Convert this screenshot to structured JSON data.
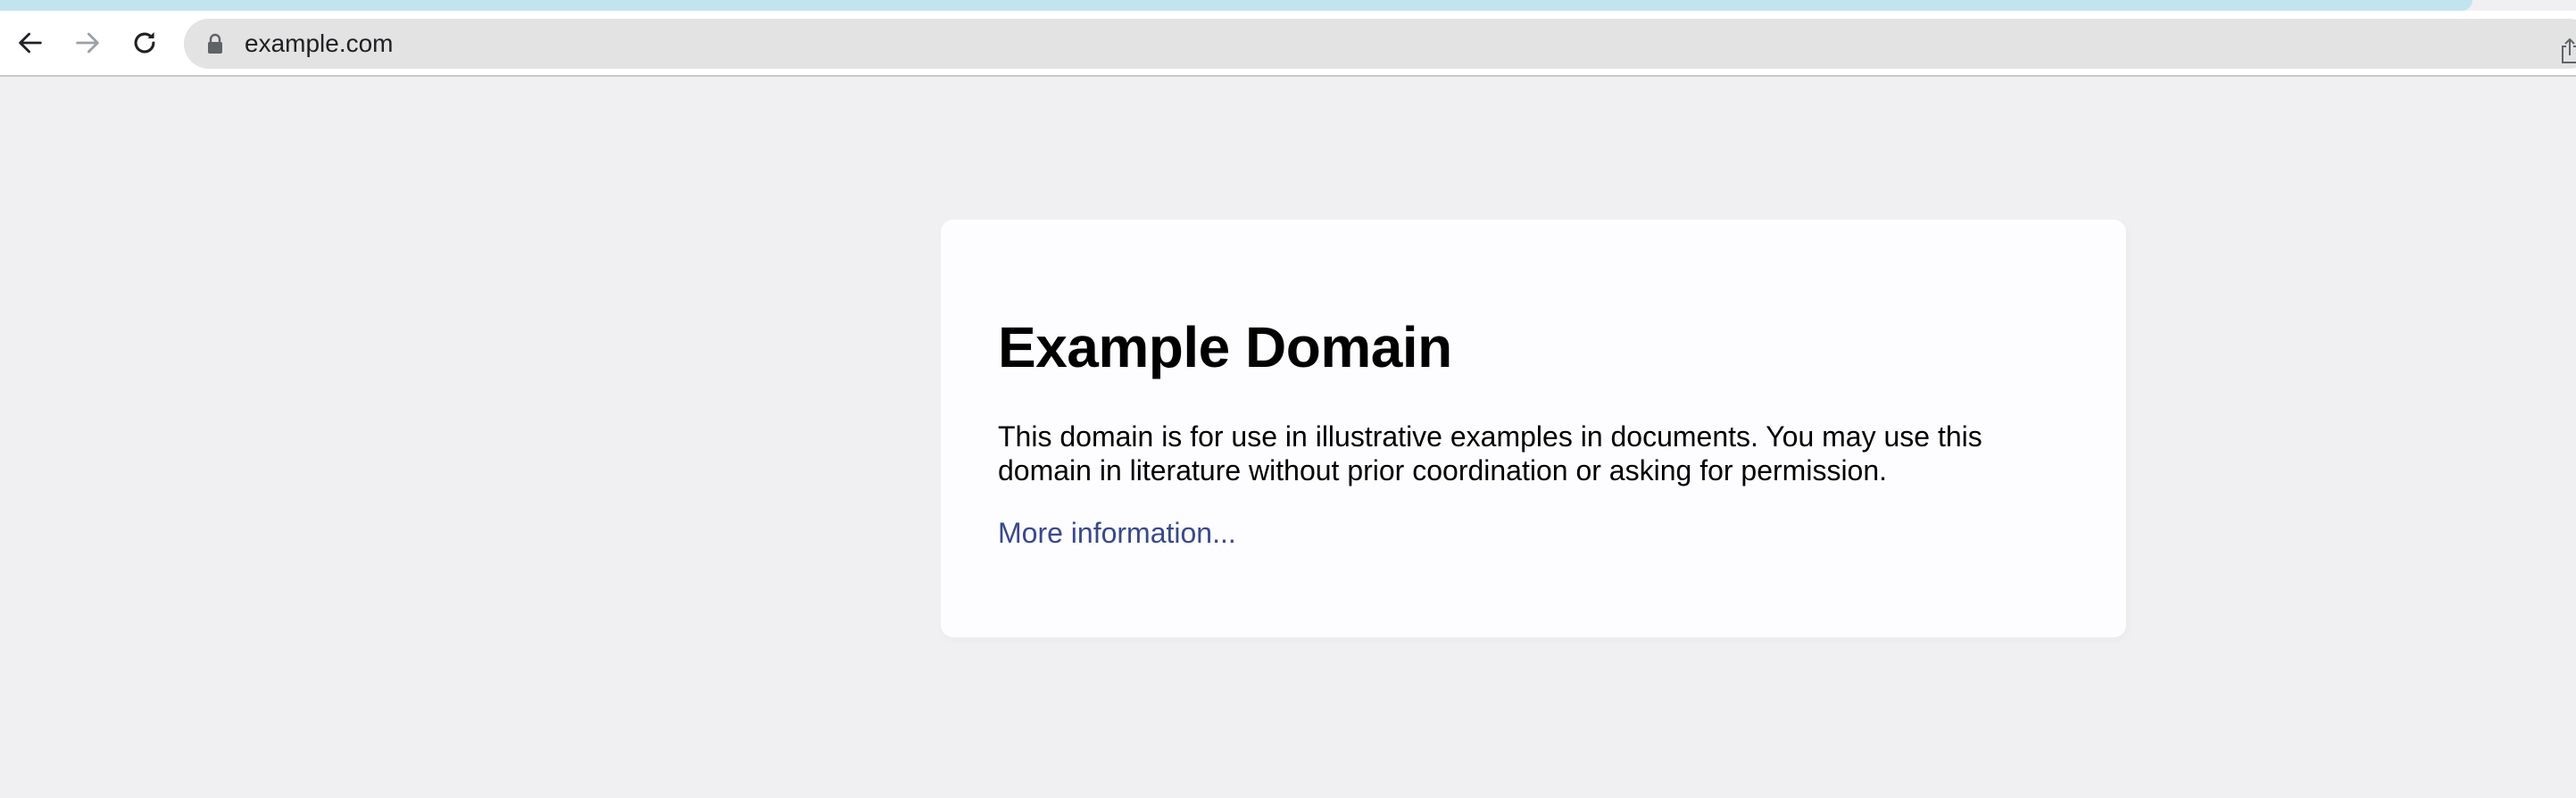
{
  "browser": {
    "address_bar": {
      "url": "example.com"
    },
    "icons": {
      "back": "arrow-left-icon",
      "forward": "arrow-right-icon",
      "reload": "reload-icon",
      "lock": "lock-icon",
      "share": "share-icon"
    },
    "colors": {
      "top_strip": "#c1e5ef",
      "toolbar": "#ffffff",
      "omnibox": "#e3e3e3"
    }
  },
  "page": {
    "title": "Example Domain",
    "description": "This domain is for use in illustrative examples in documents. You may use this domain in literature without prior coordination or asking for permission.",
    "link_text": "More information...",
    "colors": {
      "background": "#f0f0f2",
      "card": "#fdfdff",
      "link": "#38488f"
    }
  }
}
